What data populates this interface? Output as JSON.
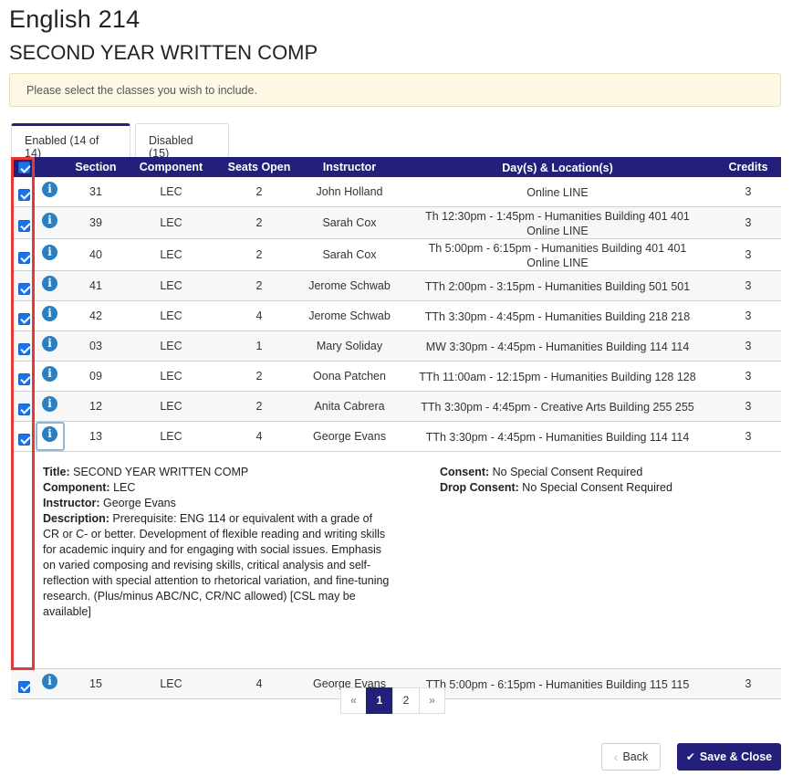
{
  "header": {
    "course_code": "English 214",
    "course_title": "SECOND YEAR WRITTEN COMP"
  },
  "notice": "Please select the classes you wish to include.",
  "tabs": [
    {
      "label": "Enabled (14 of 14)",
      "active": true
    },
    {
      "label": "Disabled (15)",
      "active": false
    }
  ],
  "table": {
    "headers": {
      "section": "Section",
      "component": "Component",
      "seats": "Seats Open",
      "instructor": "Instructor",
      "days": "Day(s) & Location(s)",
      "credits": "Credits"
    },
    "rows": [
      {
        "section": "31",
        "component": "LEC",
        "seats": "2",
        "instructor": "John Holland",
        "days": [
          "Online LINE"
        ],
        "credits": "3",
        "checked": true
      },
      {
        "section": "39",
        "component": "LEC",
        "seats": "2",
        "instructor": "Sarah Cox",
        "days": [
          "Th 12:30pm - 1:45pm - Humanities Building 401 401",
          "Online LINE"
        ],
        "credits": "3",
        "checked": true
      },
      {
        "section": "40",
        "component": "LEC",
        "seats": "2",
        "instructor": "Sarah Cox",
        "days": [
          "Th 5:00pm - 6:15pm - Humanities Building 401 401",
          "Online LINE"
        ],
        "credits": "3",
        "checked": true
      },
      {
        "section": "41",
        "component": "LEC",
        "seats": "2",
        "instructor": "Jerome Schwab",
        "days": [
          "TTh 2:00pm - 3:15pm - Humanities Building 501 501"
        ],
        "credits": "3",
        "checked": true
      },
      {
        "section": "42",
        "component": "LEC",
        "seats": "4",
        "instructor": "Jerome Schwab",
        "days": [
          "TTh 3:30pm - 4:45pm - Humanities Building 218 218"
        ],
        "credits": "3",
        "checked": true
      },
      {
        "section": "03",
        "component": "LEC",
        "seats": "1",
        "instructor": "Mary Soliday",
        "days": [
          "MW 3:30pm - 4:45pm - Humanities Building 114 114"
        ],
        "credits": "3",
        "checked": true
      },
      {
        "section": "09",
        "component": "LEC",
        "seats": "2",
        "instructor": "Oona Patchen",
        "days": [
          "TTh 11:00am - 12:15pm - Humanities Building 128 128"
        ],
        "credits": "3",
        "checked": true
      },
      {
        "section": "12",
        "component": "LEC",
        "seats": "2",
        "instructor": "Anita Cabrera",
        "days": [
          "TTh 3:30pm - 4:45pm - Creative Arts Building 255 255"
        ],
        "credits": "3",
        "checked": true
      },
      {
        "section": "13",
        "component": "LEC",
        "seats": "4",
        "instructor": "George Evans",
        "days": [
          "TTh 3:30pm - 4:45pm - Humanities Building 114 114"
        ],
        "credits": "3",
        "checked": true
      },
      {
        "section": "15",
        "component": "LEC",
        "seats": "4",
        "instructor": "George Evans",
        "days": [
          "TTh 5:00pm - 6:15pm - Humanities Building 115 115"
        ],
        "credits": "3",
        "checked": true
      }
    ]
  },
  "detail": {
    "title_label": "Title:",
    "title_value": " SECOND YEAR WRITTEN COMP",
    "component_label": "Component:",
    "component_value": " LEC",
    "instructor_label": "Instructor:",
    "instructor_value": " George Evans",
    "description_label": "Description:",
    "description_value": " Prerequisite: ENG 114 or equivalent with a grade of CR or C- or better. Development of flexible reading and writing skills for academic inquiry and for engaging with social issues. Emphasis on varied composing and revising skills, critical analysis and self-reflection with special attention to rhetorical variation, and fine-tuning research. (Plus/minus ABC/NC, CR/NC allowed) [CSL may be available]",
    "consent_label": "Consent:",
    "consent_value": " No Special Consent Required",
    "drop_consent_label": "Drop Consent:",
    "drop_consent_value": " No Special Consent Required"
  },
  "pagination": {
    "prev": "«",
    "pages": [
      "1",
      "2"
    ],
    "active": "1",
    "next": "»"
  },
  "buttons": {
    "back": "Back",
    "save": "Save & Close"
  },
  "colors": {
    "header_bg": "#231f7a",
    "checkbox": "#1a73e8",
    "info_icon": "#2a7fc1",
    "highlight": "#e03a3a",
    "notice_bg": "#fcf8e3"
  }
}
